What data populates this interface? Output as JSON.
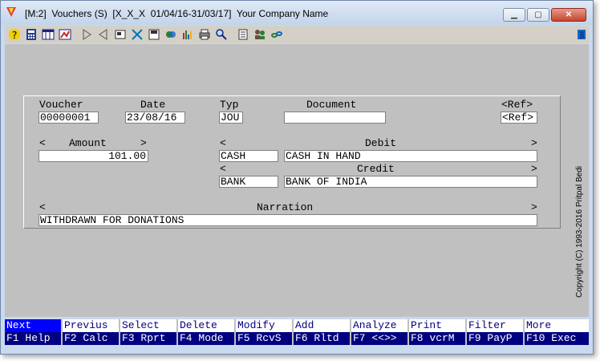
{
  "window": {
    "title": "[M:2]  Vouchers (S)  [X_X_X  01/04/16-31/03/17]  Your Company Name",
    "minimize_glyph": "▁",
    "maximize_glyph": "▢",
    "close_glyph": "✕"
  },
  "toolbar": {
    "icons": [
      "help-icon",
      "calculator-icon",
      "report-icon",
      "mode-icon",
      "next-icon",
      "previous-icon",
      "settings-icon",
      "tools-icon",
      "save-icon",
      "export-icon",
      "chart-icon",
      "print-icon",
      "search-icon",
      "notes-icon",
      "users-icon",
      "link-icon",
      "exit-icon"
    ]
  },
  "form": {
    "voucher_label": "Voucher",
    "voucher_value": "00000001",
    "date_label": "Date",
    "date_value": "23/08/16",
    "typ_label": "Typ",
    "typ_value": "JOU",
    "document_label": "Document",
    "document_value": "",
    "ref_label": "<Ref>",
    "ref_value": "<Ref>",
    "amount_left": "<",
    "amount_label": "Amount",
    "amount_right": ">",
    "amount_value": "101.00",
    "debit_left": "<",
    "debit_label": "Debit",
    "debit_right": ">",
    "debit_code": "CASH",
    "debit_name": "CASH IN HAND",
    "credit_left": "<",
    "credit_label": "Credit",
    "credit_right": ">",
    "credit_code": "BANK",
    "credit_name": "BANK OF INDIA",
    "narration_left": "<",
    "narration_label": "Narration",
    "narration_right": ">",
    "narration_value": "WITHDRAWN FOR DONATIONS"
  },
  "copyright": "Copyright (C) 1993-2016 Pritpal Bedi",
  "function_keys": [
    {
      "top": "Next",
      "bottom": "F1 Help",
      "active": true
    },
    {
      "top": "Previus",
      "bottom": "F2 Calc",
      "active": false
    },
    {
      "top": "Select",
      "bottom": "F3 Rprt",
      "active": false
    },
    {
      "top": "Delete",
      "bottom": "F4 Mode",
      "active": false
    },
    {
      "top": "Modify",
      "bottom": "F5 RcvS",
      "active": false
    },
    {
      "top": "Add",
      "bottom": "F6 Rltd",
      "active": false
    },
    {
      "top": "Analyze",
      "bottom": "F7 <<>>",
      "active": false
    },
    {
      "top": "Print",
      "bottom": "F8 vcrM",
      "active": false
    },
    {
      "top": "Filter",
      "bottom": "F9 PayP",
      "active": false
    },
    {
      "top": "More",
      "bottom": "F10 Exec",
      "active": false
    }
  ]
}
